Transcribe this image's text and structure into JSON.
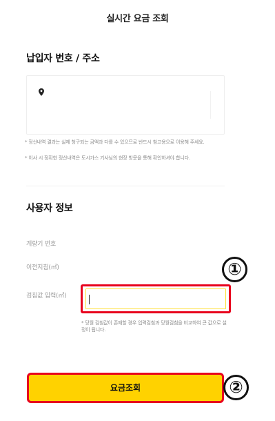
{
  "header": {
    "title": "실시간 요금 조회"
  },
  "payer_section": {
    "title": "납입자 번호 / 주소",
    "notices": [
      "* 정산내역 결과는 실제 청구되는 금액과 다를 수 있으므로 반드시 참고용으로 이용해 주세요.",
      "* 이사 시 정확한 정산내역은 도시가스 기사님의 현장 방문을 통해 확인하셔야 합니다."
    ]
  },
  "user_section": {
    "title": "사용자 정보",
    "meter_number_label": "계량기 번호",
    "previous_reading_label": "이전지침(㎥)",
    "reading_input_label": "검침값 입력(㎥)",
    "reading_input_value": "",
    "reading_note": "* 당월 검침값이 존재할 경우 입력검침과 당월검침을 비교하여 큰 값으로 설정이 됩니다."
  },
  "callouts": [
    "①",
    "②"
  ],
  "query_button_label": "요금조회",
  "colors": {
    "accent": "#ffd200",
    "highlight": "#e8001c"
  }
}
